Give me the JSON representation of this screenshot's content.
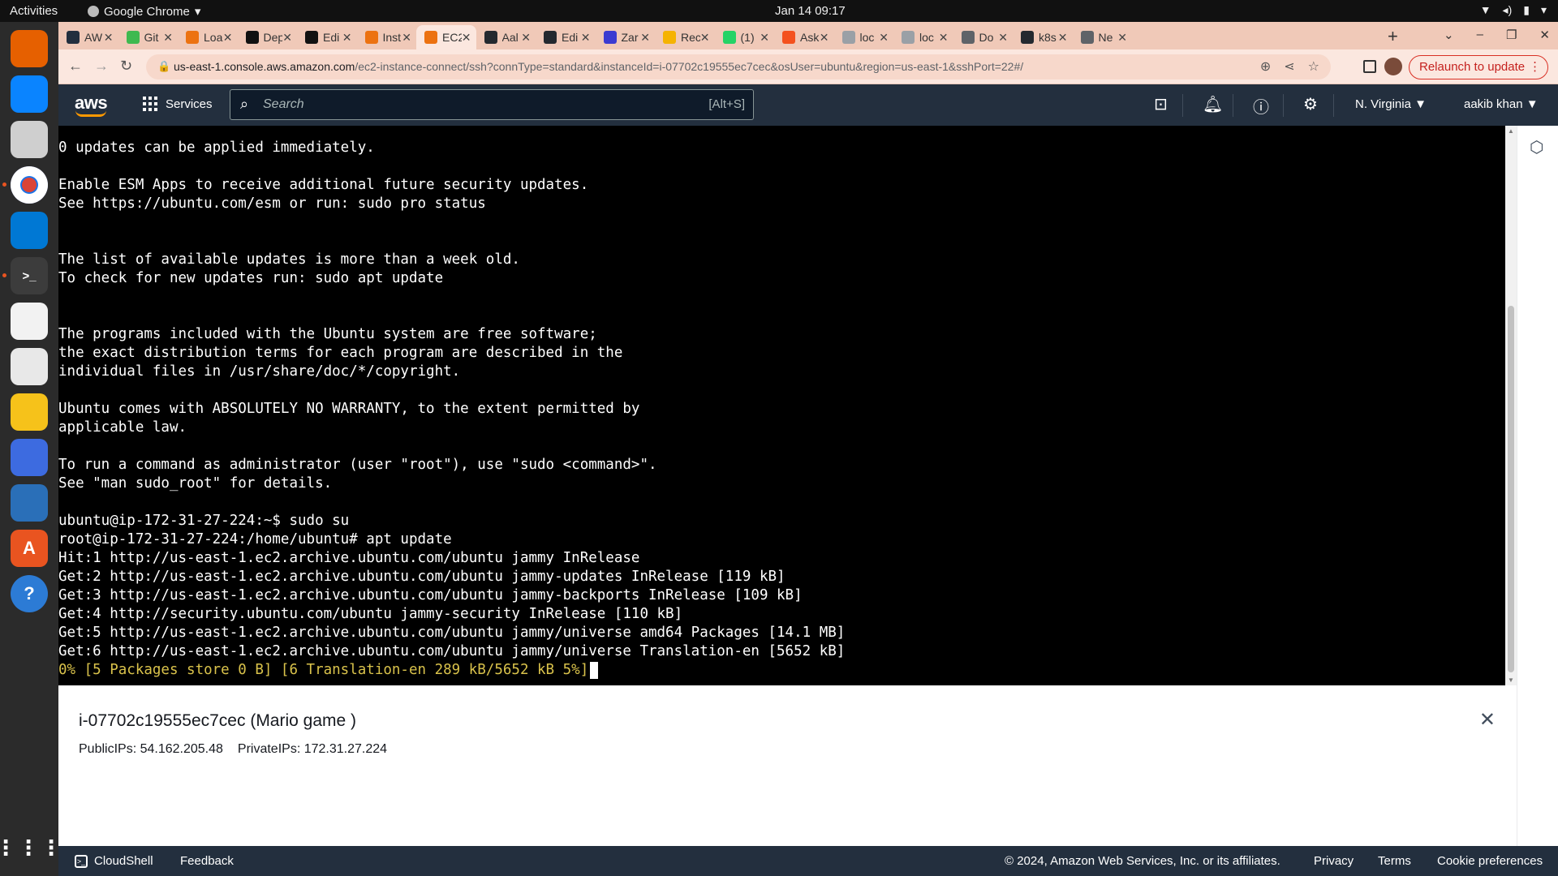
{
  "topbar": {
    "activities": "Activities",
    "app_name": "Google Chrome",
    "datetime": "Jan 14  09:17"
  },
  "browser": {
    "tabs": [
      {
        "label": "AW",
        "color": "#232f3e",
        "active": false
      },
      {
        "label": "Git",
        "color": "#3fb950",
        "active": false
      },
      {
        "label": "Loa",
        "color": "#ec7211",
        "active": false
      },
      {
        "label": "Dep",
        "color": "#111111",
        "active": false
      },
      {
        "label": "Edi",
        "color": "#111111",
        "active": false
      },
      {
        "label": "Inst",
        "color": "#ec7211",
        "active": false
      },
      {
        "label": "EC2",
        "color": "#ec7211",
        "active": true
      },
      {
        "label": "Aal",
        "color": "#24292f",
        "active": false
      },
      {
        "label": "Edi",
        "color": "#24292f",
        "active": false
      },
      {
        "label": "Zar",
        "color": "#3b3bd1",
        "active": false
      },
      {
        "label": "Rec",
        "color": "#f5b301",
        "active": false
      },
      {
        "label": "(1)",
        "color": "#25d366",
        "active": false
      },
      {
        "label": "Ask",
        "color": "#f4511e",
        "active": false
      },
      {
        "label": "loc",
        "color": "#9aa0a6",
        "active": false
      },
      {
        "label": "loc",
        "color": "#9aa0a6",
        "active": false
      },
      {
        "label": "Do",
        "color": "#5f6368",
        "active": false
      },
      {
        "label": "k8s",
        "color": "#24292f",
        "active": false
      },
      {
        "label": "Ne",
        "color": "#5f6368",
        "active": false
      }
    ],
    "url_host": "us-east-1.console.aws.amazon.com",
    "url_path": "/ec2-instance-connect/ssh?connType=standard&instanceId=i-07702c19555ec7cec&osUser=ubuntu&region=us-east-1&sshPort=22#/",
    "relaunch_label": "Relaunch to update"
  },
  "aws_nav": {
    "logo": "aws",
    "services_label": "Services",
    "search_placeholder": "Search",
    "search_hotkey": "[Alt+S]",
    "region": "N. Virginia",
    "user": "aakib khan"
  },
  "terminal": {
    "lines": [
      "0 updates can be applied immediately.",
      "",
      "Enable ESM Apps to receive additional future security updates.",
      "See https://ubuntu.com/esm or run: sudo pro status",
      "",
      "",
      "The list of available updates is more than a week old.",
      "To check for new updates run: sudo apt update",
      "",
      "",
      "The programs included with the Ubuntu system are free software;",
      "the exact distribution terms for each program are described in the",
      "individual files in /usr/share/doc/*/copyright.",
      "",
      "Ubuntu comes with ABSOLUTELY NO WARRANTY, to the extent permitted by",
      "applicable law.",
      "",
      "To run a command as administrator (user \"root\"), use \"sudo <command>\".",
      "See \"man sudo_root\" for details.",
      "",
      "ubuntu@ip-172-31-27-224:~$ sudo su",
      "root@ip-172-31-27-224:/home/ubuntu# apt update",
      "Hit:1 http://us-east-1.ec2.archive.ubuntu.com/ubuntu jammy InRelease",
      "Get:2 http://us-east-1.ec2.archive.ubuntu.com/ubuntu jammy-updates InRelease [119 kB]",
      "Get:3 http://us-east-1.ec2.archive.ubuntu.com/ubuntu jammy-backports InRelease [109 kB]",
      "Get:4 http://security.ubuntu.com/ubuntu jammy-security InRelease [110 kB]",
      "Get:5 http://us-east-1.ec2.archive.ubuntu.com/ubuntu jammy/universe amd64 Packages [14.1 MB]",
      "Get:6 http://us-east-1.ec2.archive.ubuntu.com/ubuntu jammy/universe Translation-en [5652 kB]"
    ],
    "progress_line": "0% [5 Packages store 0 B] [6 Translation-en 289 kB/5652 kB 5%]",
    "progress_color": "#d9c24b"
  },
  "instance_panel": {
    "title": "i-07702c19555ec7cec (Mario game )",
    "public_ips": "PublicIPs: 54.162.205.48",
    "private_ips": "PrivateIPs: 172.31.27.224"
  },
  "footer": {
    "cloudshell": "CloudShell",
    "feedback": "Feedback",
    "copyright": "© 2024, Amazon Web Services, Inc. or its affiliates.",
    "privacy": "Privacy",
    "terms": "Terms",
    "cookies": "Cookie preferences"
  },
  "dock": {
    "apps": [
      {
        "name": "firefox-icon",
        "color": "#e66000"
      },
      {
        "name": "thunderbird-icon",
        "color": "#0a84ff"
      },
      {
        "name": "files-icon",
        "color": "#cfcfcf"
      },
      {
        "name": "chrome-icon",
        "color": "#db4437"
      },
      {
        "name": "vscode-icon",
        "color": "#0078d4"
      },
      {
        "name": "terminal-icon",
        "color": "#3c3c3c"
      },
      {
        "name": "text-editor-icon",
        "color": "#f2f2f2"
      },
      {
        "name": "document-viewer-icon",
        "color": "#e8e8e8"
      },
      {
        "name": "rhythmbox-icon",
        "color": "#f6c21a"
      },
      {
        "name": "screenshot-icon",
        "color": "#3d6be0"
      },
      {
        "name": "writer-icon",
        "color": "#2a6fb8"
      },
      {
        "name": "app-center-icon",
        "color": "#e95420"
      },
      {
        "name": "help-icon",
        "color": "#2c7bd5"
      }
    ]
  }
}
